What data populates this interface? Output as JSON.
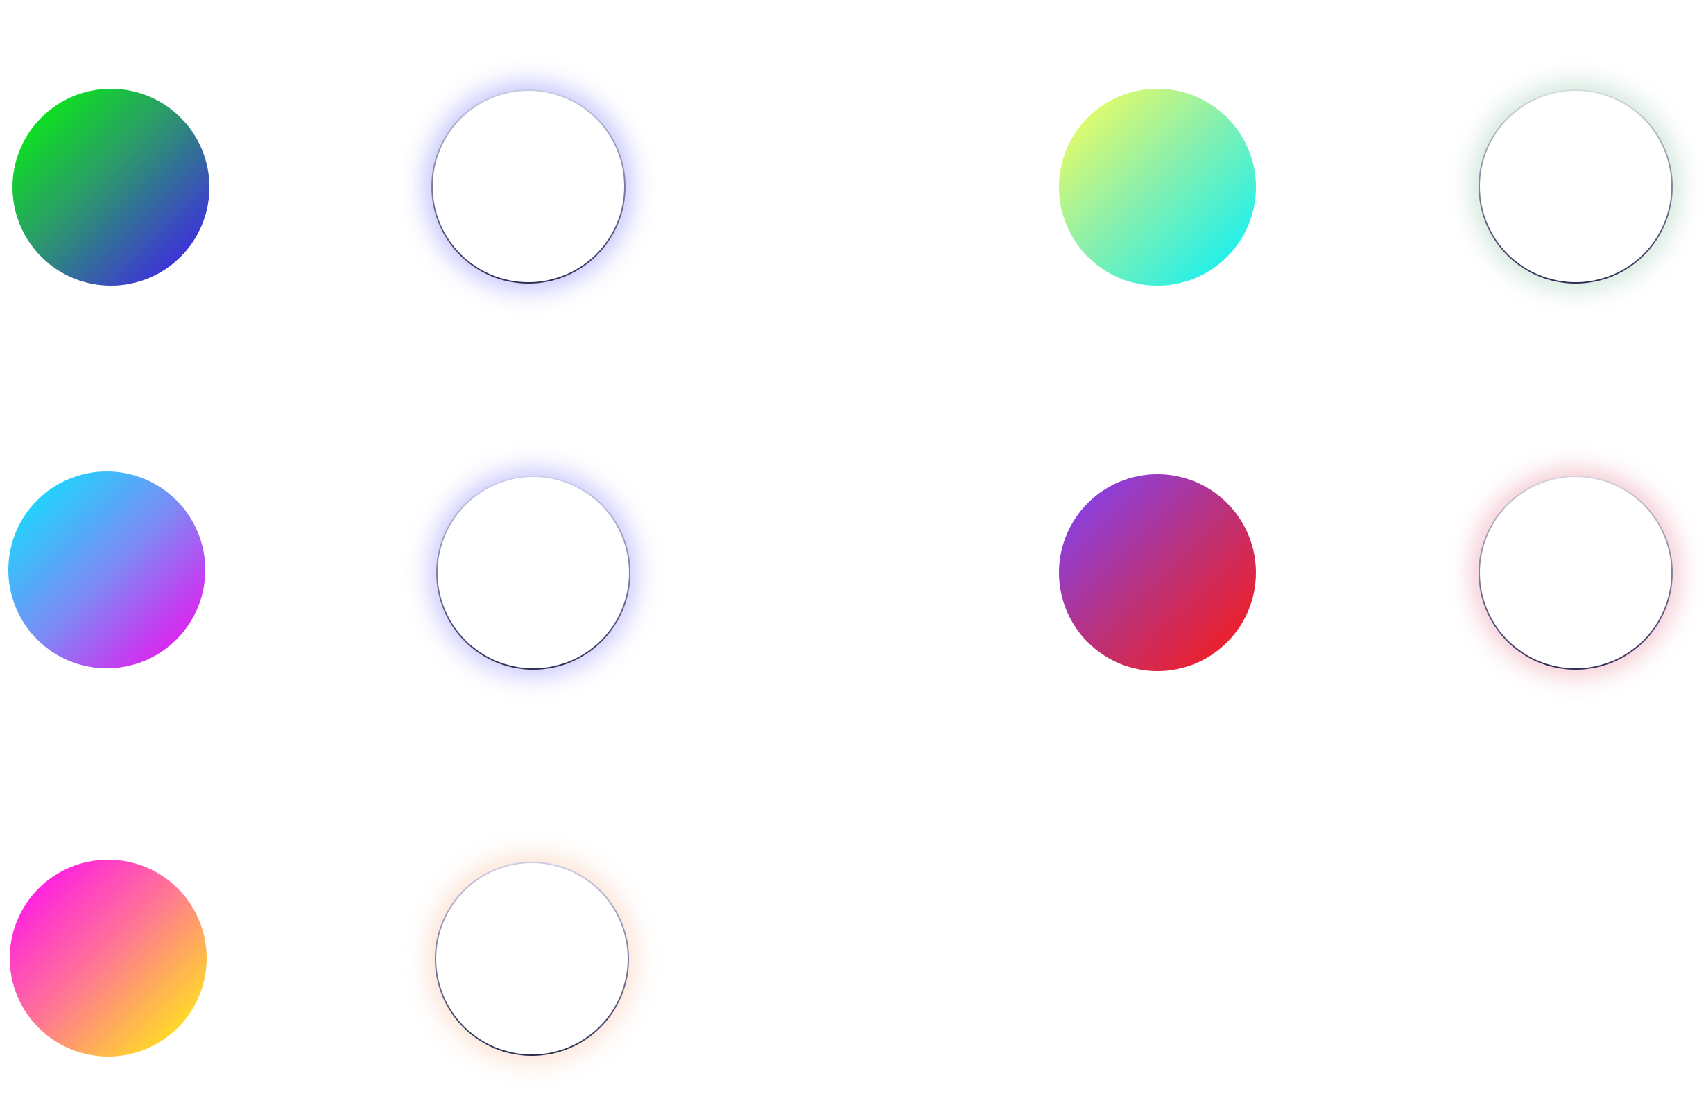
{
  "swatches": [
    {
      "id": "pair-1",
      "gradient_start": "#00ff00",
      "gradient_end": "#4411ff",
      "glow_color": "#5a5af5"
    },
    {
      "id": "pair-2",
      "gradient_start": "#ffff55",
      "gradient_end": "#00f0ff",
      "glow_color": "#5aaa82"
    },
    {
      "id": "pair-3",
      "gradient_start": "#00eeff",
      "gradient_end": "#ff00ee",
      "glow_color": "#6e64f5"
    },
    {
      "id": "pair-4",
      "gradient_start": "#7a44ff",
      "gradient_end": "#ff1a10",
      "glow_color": "#dc506e"
    },
    {
      "id": "pair-5",
      "gradient_start": "#ff00ff",
      "gradient_end": "#ffff00",
      "glow_color": "#f59664"
    }
  ],
  "background_color": "#ffffff",
  "outline_stroke_color": "#2d2d55"
}
